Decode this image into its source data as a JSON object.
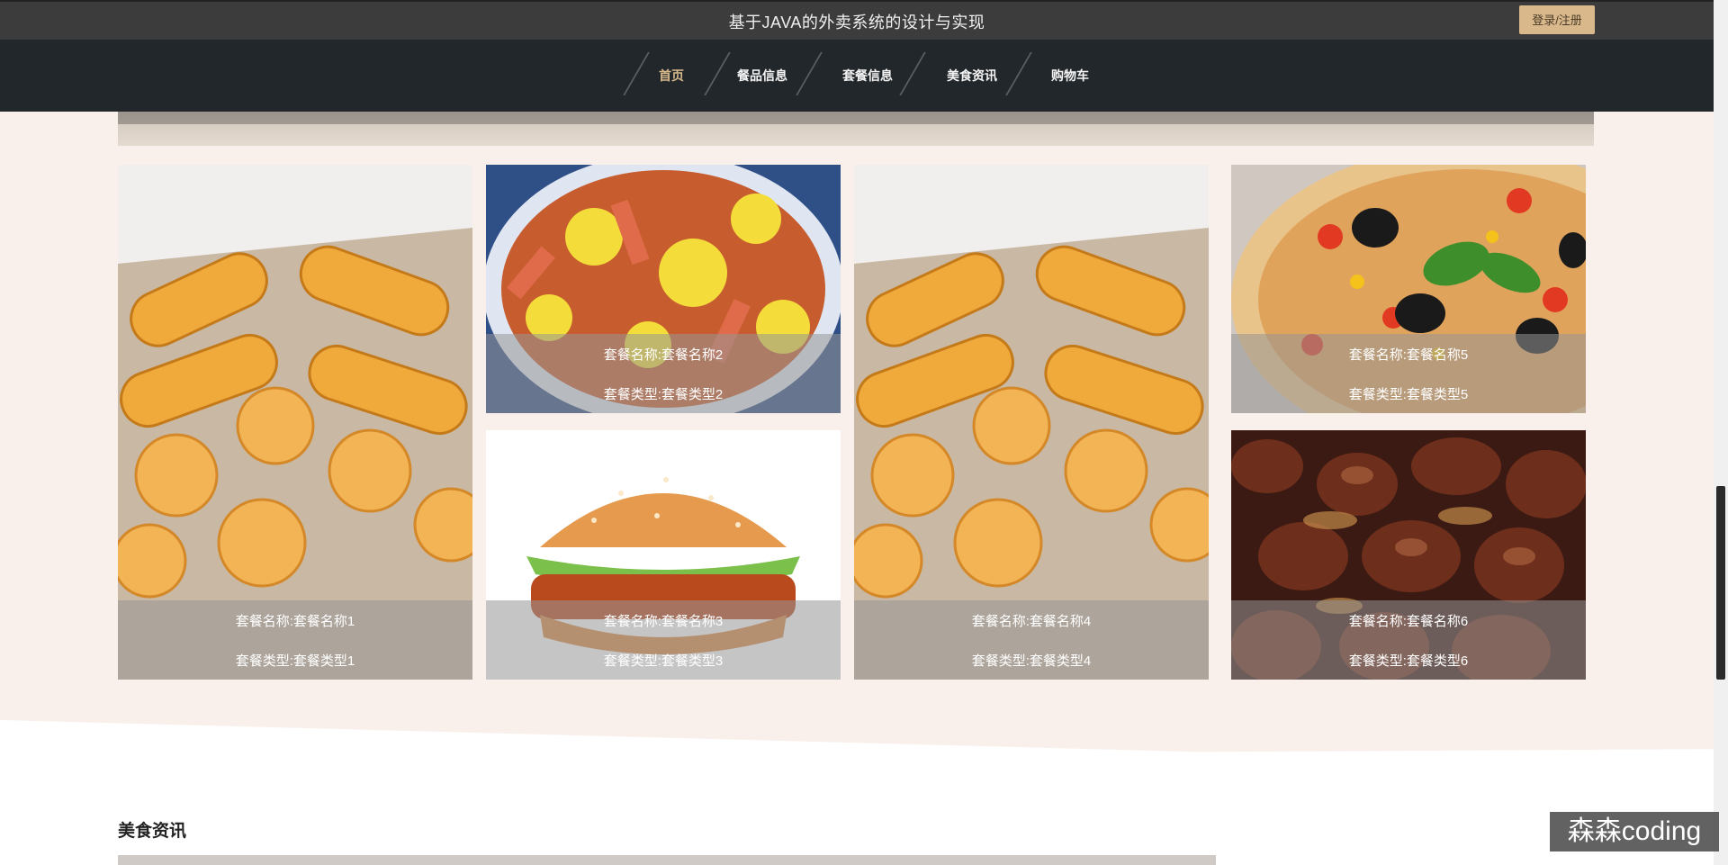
{
  "header": {
    "title": "基于JAVA的外卖系统的设计与实现",
    "login_label": "登录/注册"
  },
  "nav": {
    "items": [
      {
        "label": "首页",
        "active": true
      },
      {
        "label": "餐品信息",
        "active": false
      },
      {
        "label": "套餐信息",
        "active": false
      },
      {
        "label": "美食资讯",
        "active": false
      },
      {
        "label": "购物车",
        "active": false
      }
    ]
  },
  "packages": [
    {
      "name": "套餐名称:套餐名称1",
      "type": "套餐类型:套餐类型1",
      "image": "bread-icon"
    },
    {
      "name": "套餐名称:套餐名称2",
      "type": "套餐类型:套餐类型2",
      "image": "stir-fry-icon"
    },
    {
      "name": "套餐名称:套餐名称3",
      "type": "套餐类型:套餐类型3",
      "image": "burger-icon"
    },
    {
      "name": "套餐名称:套餐名称4",
      "type": "套餐类型:套餐类型4",
      "image": "bread-icon"
    },
    {
      "name": "套餐名称:套餐名称5",
      "type": "套餐类型:套餐类型5",
      "image": "pizza-icon"
    },
    {
      "name": "套餐名称:套餐名称6",
      "type": "套餐类型:套餐类型6",
      "image": "braised-liver-icon"
    }
  ],
  "news": {
    "title": "美食资讯"
  },
  "watermark": "森森coding",
  "colors": {
    "accent": "#d9b98c",
    "topbar": "#3c3c3c",
    "navbar": "#22272b",
    "page_bg": "#f9f0eb"
  }
}
